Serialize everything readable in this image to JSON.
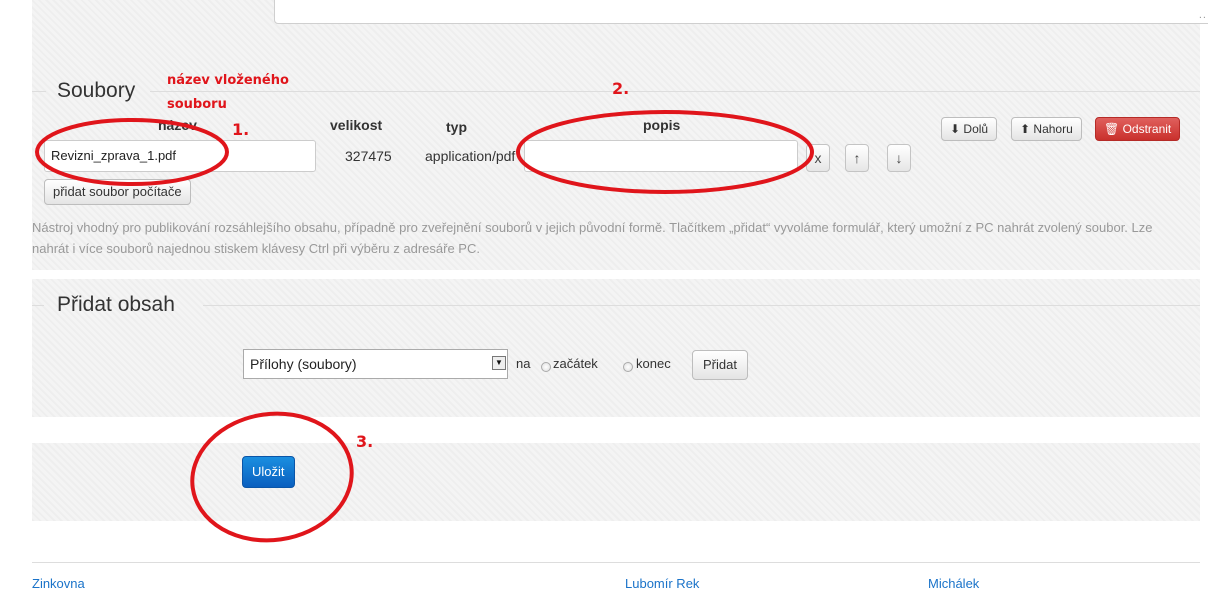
{
  "top": {
    "textarea_grip": "..."
  },
  "files": {
    "legend": "Soubory",
    "columns": {
      "name": "název",
      "size": "velikost",
      "type": "typ",
      "description": "popis"
    },
    "row": {
      "name": "Revizni_zprava_1.pdf",
      "size": "327475",
      "type": "application/pdf",
      "description": "",
      "remove_glyph": "x",
      "up_glyph": "↑",
      "down_glyph": "↓"
    },
    "add_from_computer": "přidat soubor počítače",
    "help": "Nástroj vhodný pro publikování rozsáhlejšího obsahu, případně pro zveřejnění souborů v jejich původní formě. Tlačítkem „přidat“ vyvoláme formulář, který umožní z PC nahrát zvolený soubor. Lze nahrát i více souborů najednou stiskem klávesy Ctrl při výběru z adresáře PC.",
    "toolbar": {
      "down": "Dolů",
      "up": "Nahoru",
      "remove": "Odstranit"
    }
  },
  "add_content": {
    "legend": "Přidat obsah",
    "select_value": "Přílohy (soubory)",
    "na": "na",
    "begin": "začátek",
    "end": "konec",
    "add_button": "Přidat"
  },
  "save": {
    "button": "Uložit"
  },
  "footer": {
    "left": "Zinkovna",
    "middle": "Lubomír Rek",
    "right": "Michálek"
  },
  "annotations": {
    "label_filename": "název vloženého\nsouboru",
    "step1": "1.",
    "step2": "2.",
    "step3": "3.",
    "color": "#e0151b"
  }
}
